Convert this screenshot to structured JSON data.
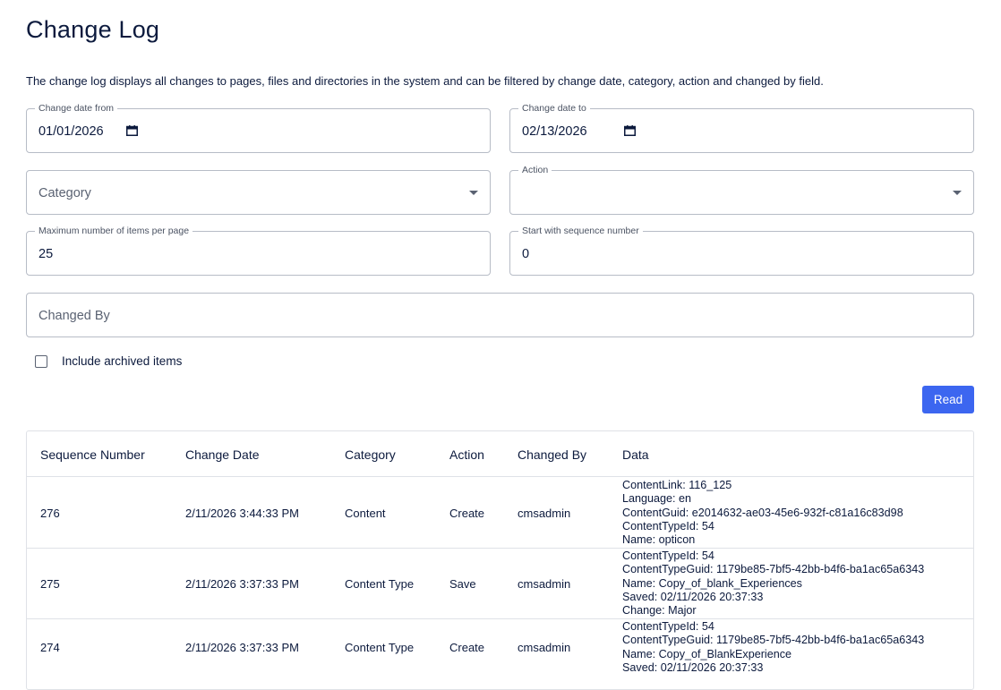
{
  "page": {
    "title": "Change Log",
    "description": "The change log displays all changes to pages, files and directories in the system and can be filtered by change date, category, action and changed by field."
  },
  "filters": {
    "date_from": {
      "label": "Change date from",
      "value": "01/01/2026"
    },
    "date_to": {
      "label": "Change date to",
      "value": "02/13/2026"
    },
    "category": {
      "placeholder": "Category"
    },
    "action": {
      "label": "Action",
      "value": ""
    },
    "max_items": {
      "label": "Maximum number of items per page",
      "value": "25"
    },
    "start_seq": {
      "label": "Start with sequence number",
      "value": "0"
    },
    "changed_by": {
      "placeholder": "Changed By"
    },
    "include_archived": {
      "label": "Include archived items",
      "checked": false
    },
    "read_button": "Read"
  },
  "table": {
    "headers": [
      "Sequence Number",
      "Change Date",
      "Category",
      "Action",
      "Changed By",
      "Data"
    ],
    "rows": [
      {
        "seq": "276",
        "date": "2/11/2026 3:44:33 PM",
        "category": "Content",
        "action": "Create",
        "changed_by": "cmsadmin",
        "data": [
          "ContentLink: 116_125",
          "Language: en",
          "ContentGuid: e2014632-ae03-45e6-932f-c81a16c83d98",
          "ContentTypeId: 54",
          "Name: opticon"
        ]
      },
      {
        "seq": "275",
        "date": "2/11/2026 3:37:33 PM",
        "category": "Content Type",
        "action": "Save",
        "changed_by": "cmsadmin",
        "data": [
          "ContentTypeId: 54",
          "ContentTypeGuid: 1179be85-7bf5-42bb-b4f6-ba1ac65a6343",
          "Name: Copy_of_blank_Experiences",
          "Saved: 02/11/2026 20:37:33",
          "Change: Major"
        ]
      },
      {
        "seq": "274",
        "date": "2/11/2026 3:37:33 PM",
        "category": "Content Type",
        "action": "Create",
        "changed_by": "cmsadmin",
        "data": [
          "ContentTypeId: 54",
          "ContentTypeGuid: 1179be85-7bf5-42bb-b4f6-ba1ac65a6343",
          "Name: Copy_of_BlankExperience",
          "Saved: 02/11/2026 20:37:33"
        ]
      }
    ]
  },
  "colors": {
    "accent": "#3c66f0",
    "text": "#0c1a3d",
    "border": "#b7bcc6"
  }
}
